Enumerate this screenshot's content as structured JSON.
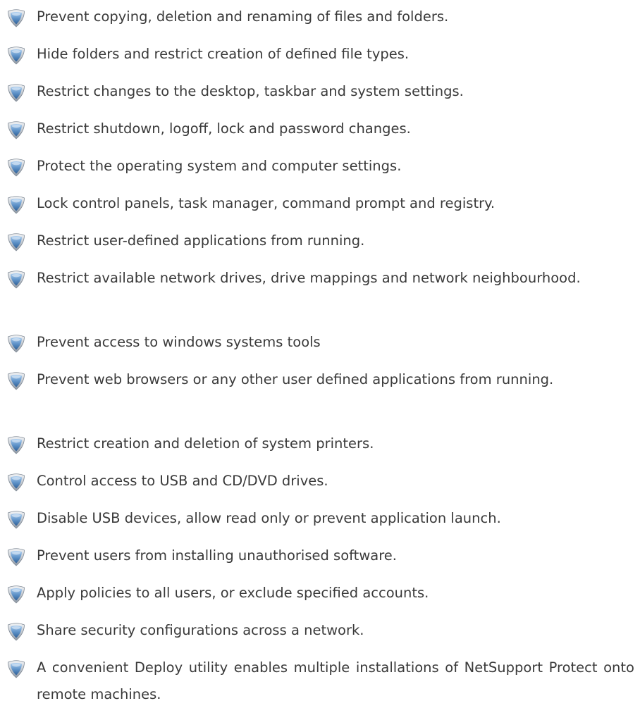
{
  "bullet_icon": "shield-icon",
  "colors": {
    "text": "#3a3a3a",
    "shield_blue": "#5a8fc4",
    "shield_silver": "#c9ced5"
  },
  "features": [
    "Prevent copying, deletion and renaming of files and folders.",
    "Hide folders and restrict creation of defined file types.",
    "Restrict changes to the desktop, taskbar and system settings.",
    "Restrict shutdown, logoff, lock and password changes.",
    "Protect the operating system and computer settings.",
    "Lock control panels, task manager, command prompt and registry.",
    "Restrict user-defined applications from running.",
    "Restrict available network drives, drive mappings and network neighbourhood.",
    "Prevent access to windows systems tools",
    "Prevent web browsers or any other user defined applications from running.",
    "Restrict creation and deletion of system printers.",
    "Control access to USB and CD/DVD drives.",
    "Disable USB devices, allow read only or prevent application launch.",
    "Prevent users from installing unauthorised software.",
    "Apply policies to all users, or exclude specified accounts.",
    "Share security configurations across a network.",
    "A convenient Deploy utility enables multiple installations of NetSupport Protect onto remote machines."
  ]
}
